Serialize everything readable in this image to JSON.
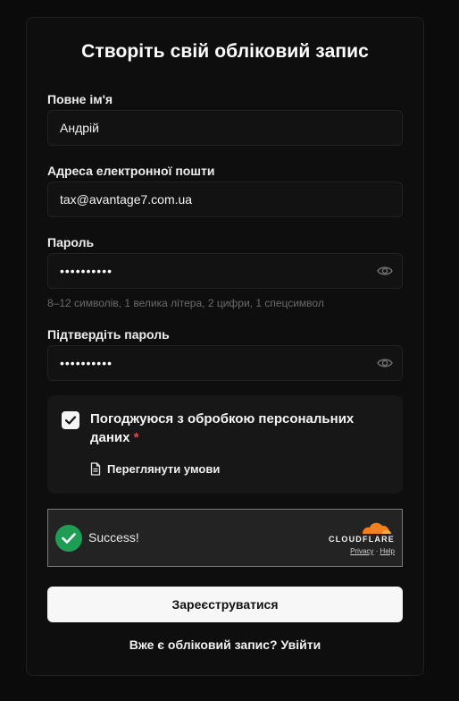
{
  "form": {
    "title": "Створіть свій обліковий запис",
    "full_name": {
      "label": "Повне ім'я",
      "value": "Андрій"
    },
    "email": {
      "label": "Адреса електронної пошти",
      "value": "tax@avantage7.com.ua"
    },
    "password": {
      "label": "Пароль",
      "masked_value": "••••••••••",
      "hint": "8–12 символів, 1 велика літера, 2 цифри, 1 спецсимвол"
    },
    "confirm_password": {
      "label": "Підтвердіть пароль",
      "masked_value": "••••••••••"
    },
    "consent": {
      "checked": true,
      "text": "Погоджуюся з обробкою персональних даних",
      "required_mark": "*",
      "terms_link": "Переглянути умови"
    },
    "captcha": {
      "status": "Success!",
      "brand": "CLOUDFLARE",
      "privacy": "Privacy",
      "separator": "·",
      "help": "Help"
    },
    "submit_label": "Зареєструватися",
    "login_prompt": "Вже є обліковий запис?",
    "login_link": "Увійти"
  },
  "colors": {
    "background": "#0b0b0b",
    "card": "#0e0e0e",
    "accent_success": "#1f9d55",
    "cloudflare_orange": "#f38020",
    "required": "#e5484d"
  },
  "icons": {
    "password_toggle": "eye-icon",
    "checkbox": "check-icon",
    "terms": "document-icon",
    "captcha_status": "check-circle-icon",
    "captcha_brand": "cloud-icon"
  }
}
